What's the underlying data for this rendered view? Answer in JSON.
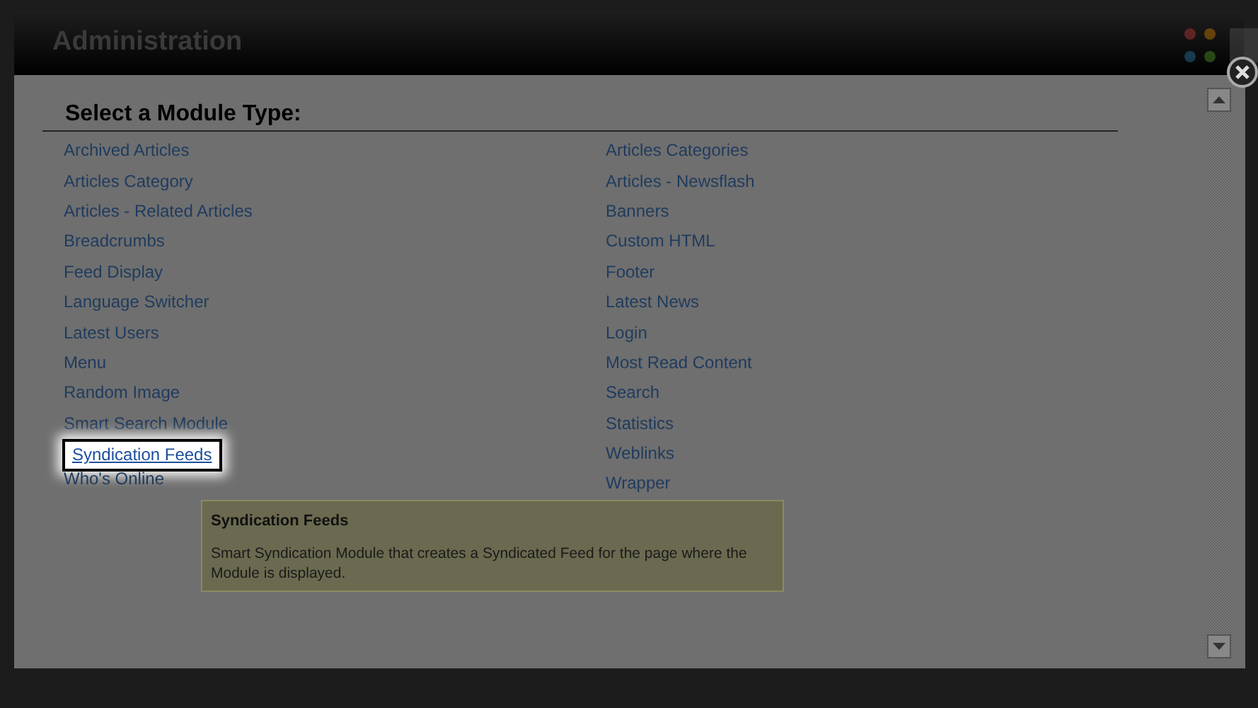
{
  "header": {
    "title": "Administration"
  },
  "dialog": {
    "heading": "Select a Module Type:",
    "columns": [
      [
        {
          "label": "Archived Articles",
          "selected": false
        },
        {
          "label": "Articles Category",
          "selected": false
        },
        {
          "label": "Articles - Related Articles",
          "selected": false
        },
        {
          "label": "Breadcrumbs",
          "selected": false
        },
        {
          "label": "Feed Display",
          "selected": false
        },
        {
          "label": "Language Switcher",
          "selected": false
        },
        {
          "label": "Latest Users",
          "selected": false
        },
        {
          "label": "Menu",
          "selected": false
        },
        {
          "label": "Random Image",
          "selected": false
        },
        {
          "label": "Smart Search Module",
          "selected": false
        },
        {
          "label": "Syndication Feeds",
          "selected": true
        },
        {
          "label": "Who's Online",
          "selected": false
        }
      ],
      [
        {
          "label": "Articles Categories",
          "selected": false
        },
        {
          "label": "Articles - Newsflash",
          "selected": false
        },
        {
          "label": "Banners",
          "selected": false
        },
        {
          "label": "Custom HTML",
          "selected": false
        },
        {
          "label": "Footer",
          "selected": false
        },
        {
          "label": "Latest News",
          "selected": false
        },
        {
          "label": "Login",
          "selected": false
        },
        {
          "label": "Most Read Content",
          "selected": false
        },
        {
          "label": "Search",
          "selected": false
        },
        {
          "label": "Statistics",
          "selected": false
        },
        {
          "label": "Weblinks",
          "selected": false
        },
        {
          "label": "Wrapper",
          "selected": false
        }
      ]
    ],
    "tooltip": {
      "title": "Syndication Feeds",
      "text": "Smart Syndication Module that creates a Syndicated Feed for the page where the Module is displayed."
    }
  }
}
